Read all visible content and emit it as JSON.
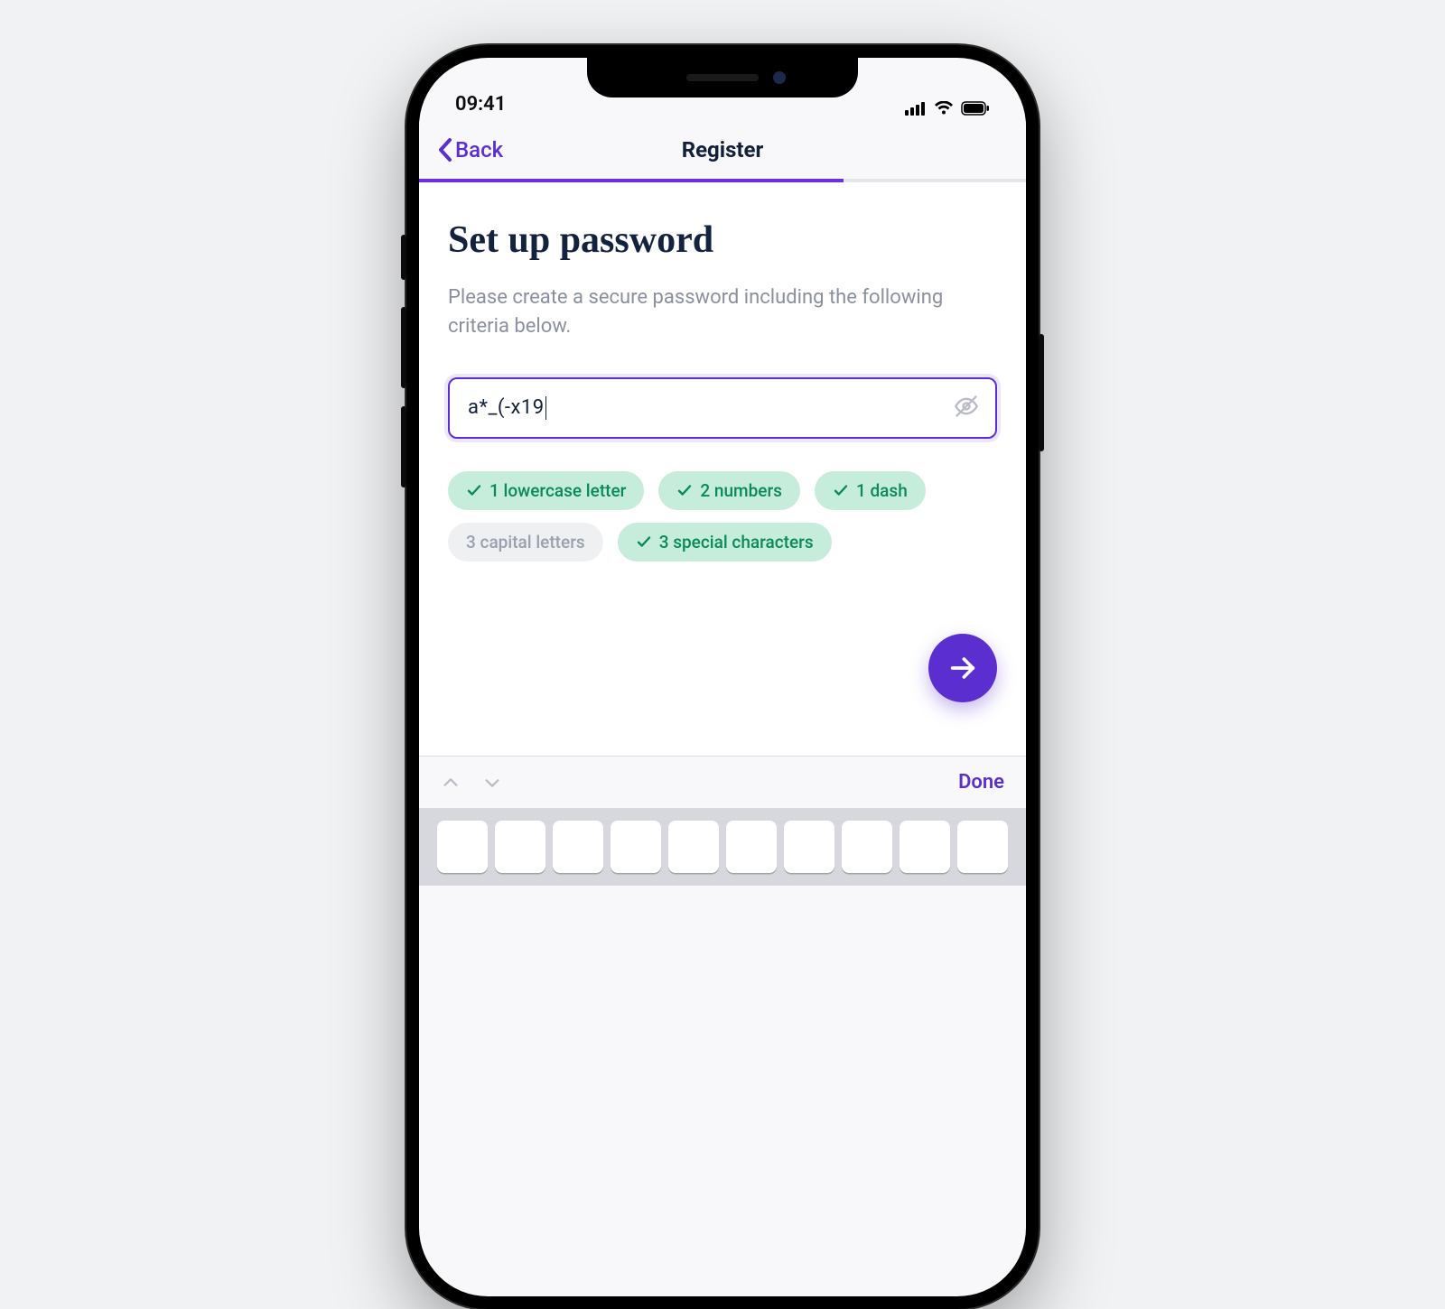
{
  "status": {
    "time": "09:41"
  },
  "nav": {
    "back_label": "Back",
    "title": "Register",
    "progress_percent": 70
  },
  "page": {
    "heading": "Set up password",
    "subtext": "Please create a secure password including the following criteria below."
  },
  "password": {
    "value": "a*_(-x19"
  },
  "criteria": [
    {
      "label": "1 lowercase letter",
      "met": true
    },
    {
      "label": "2 numbers",
      "met": true
    },
    {
      "label": "1 dash",
      "met": true
    },
    {
      "label": "3 capital letters",
      "met": false
    },
    {
      "label": "3 special characters",
      "met": true
    }
  ],
  "keyboard": {
    "done_label": "Done"
  },
  "colors": {
    "accent": "#5b2ed0",
    "success_bg": "#c6ecdc",
    "success_text": "#0a8a57"
  }
}
